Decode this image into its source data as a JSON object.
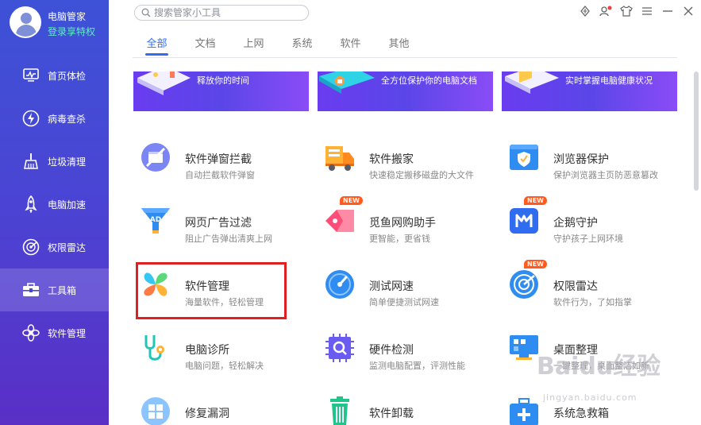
{
  "profile": {
    "name": "电脑管家",
    "vip_link": "登录享特权"
  },
  "sidebar": {
    "items": [
      {
        "label": "首页体检",
        "icon": "monitor-icon"
      },
      {
        "label": "病毒查杀",
        "icon": "lightning-icon"
      },
      {
        "label": "垃圾清理",
        "icon": "broom-icon"
      },
      {
        "label": "电脑加速",
        "icon": "rocket-icon"
      },
      {
        "label": "权限雷达",
        "icon": "radar-icon"
      },
      {
        "label": "工具箱",
        "icon": "toolbox-icon",
        "active": true
      },
      {
        "label": "软件管理",
        "icon": "software-icon"
      }
    ]
  },
  "search": {
    "placeholder": "搜索管家小工具"
  },
  "tabs": [
    "全部",
    "文档",
    "上网",
    "系统",
    "软件",
    "其他"
  ],
  "active_tab": "全部",
  "banners": [
    "释放你的时间",
    "全方位保护你的电脑文档",
    "实时掌握电脑健康状况"
  ],
  "tools": [
    {
      "name": "软件弹窗拦截",
      "desc": "自动拦截软件弹窗",
      "icon": "popup-block-icon",
      "new": false
    },
    {
      "name": "软件搬家",
      "desc": "快速稳定搬移磁盘的大文件",
      "icon": "moving-truck-icon",
      "new": false
    },
    {
      "name": "浏览器保护",
      "desc": "保护浏览器主页防恶意篡改",
      "icon": "browser-shield-icon",
      "new": false
    },
    {
      "name": "网页广告过滤",
      "desc": "阻止广告弹出清爽上网",
      "icon": "ad-filter-icon",
      "new": false
    },
    {
      "name": "觅鱼网购助手",
      "desc": "更智能，更省钱",
      "icon": "shopping-tag-icon",
      "new": true
    },
    {
      "name": "企鹅守护",
      "desc": "守护孩子上网环境",
      "icon": "penguin-guard-icon",
      "new": true
    },
    {
      "name": "软件管理",
      "desc": "海量软件，轻松管理",
      "icon": "software-manager-icon",
      "new": false
    },
    {
      "name": "测试网速",
      "desc": "简单便捷测试网速",
      "icon": "speedometer-icon",
      "new": false
    },
    {
      "name": "权限雷达",
      "desc": "软件行为，了如指掌",
      "icon": "radar-icon",
      "new": true
    },
    {
      "name": "电脑诊所",
      "desc": "电脑问题，轻松解决",
      "icon": "stethoscope-icon",
      "new": false
    },
    {
      "name": "硬件检测",
      "desc": "监测电脑配置，评测性能",
      "icon": "chip-icon",
      "new": false
    },
    {
      "name": "桌面整理",
      "desc": "一键整理，桌面整洁如新",
      "icon": "desktop-organize-icon",
      "new": false
    },
    {
      "name": "修复漏洞",
      "desc": "",
      "icon": "windows-repair-icon",
      "new": false
    },
    {
      "name": "软件卸载",
      "desc": "",
      "icon": "trash-icon",
      "new": false
    },
    {
      "name": "系统急救箱",
      "desc": "",
      "icon": "first-aid-icon",
      "new": false
    }
  ],
  "new_badge": "NEW",
  "watermark": {
    "main": "Baidu经验",
    "sub": "jingyan.baidu.com"
  },
  "colors": {
    "accent": "#2f6cf0",
    "sidebar_top": "#3d52d6",
    "sidebar_bottom": "#5a2fc6",
    "highlight": "#e02020",
    "new_badge": "#ff5a1f"
  }
}
